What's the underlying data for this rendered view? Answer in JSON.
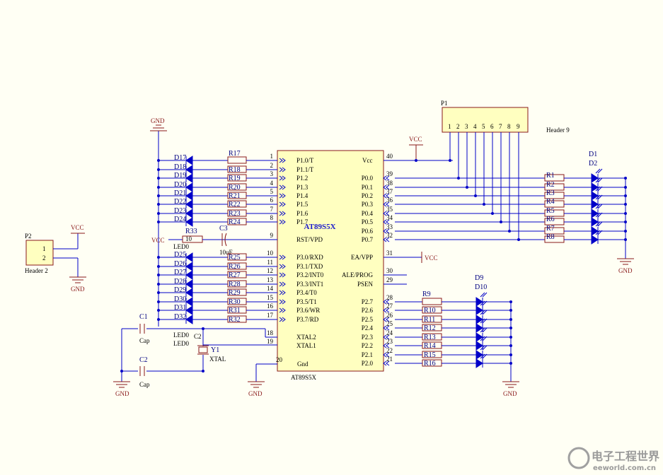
{
  "colors": {
    "wire": "#0000c8",
    "component": "#8a1a1a",
    "chip_fill": "#ffffc0",
    "background": "#fffff4",
    "chip_title": "#1a1acc"
  },
  "mcu": {
    "designator": "AT89S5X",
    "name": "AT89S5X",
    "vcc_label": "Vcc",
    "vcc_pin": "40",
    "gnd_label": "Gnd",
    "gnd_pin": "20",
    "left_pins": [
      {
        "num": "1",
        "name": "P1.0/T"
      },
      {
        "num": "2",
        "name": "P1.1/T"
      },
      {
        "num": "3",
        "name": "P1.2"
      },
      {
        "num": "4",
        "name": "P1.3"
      },
      {
        "num": "5",
        "name": "P1.4"
      },
      {
        "num": "6",
        "name": "P1.5"
      },
      {
        "num": "7",
        "name": "P1.6"
      },
      {
        "num": "8",
        "name": "P1.7"
      },
      {
        "num": "9",
        "name": "RST/VPD"
      },
      {
        "num": "10",
        "name": "P3.0/RXD"
      },
      {
        "num": "11",
        "name": "P3.1/TXD"
      },
      {
        "num": "12",
        "name": "P3.2/INT0"
      },
      {
        "num": "13",
        "name": "P3.3/INT1"
      },
      {
        "num": "14",
        "name": "P3.4/T0"
      },
      {
        "num": "15",
        "name": "P3.5/T1"
      },
      {
        "num": "16",
        "name": "P3.6/WR"
      },
      {
        "num": "17",
        "name": "P3.7/RD"
      },
      {
        "num": "18",
        "name": "XTAL2"
      },
      {
        "num": "19",
        "name": "XTAL1"
      }
    ],
    "right_pins": [
      {
        "num": "39",
        "name": "P0.0"
      },
      {
        "num": "38",
        "name": "P0.1"
      },
      {
        "num": "37",
        "name": "P0.2"
      },
      {
        "num": "36",
        "name": "P0.3"
      },
      {
        "num": "35",
        "name": "P0.4"
      },
      {
        "num": "34",
        "name": "P0.5"
      },
      {
        "num": "33",
        "name": "P0.6"
      },
      {
        "num": "32",
        "name": "P0.7"
      },
      {
        "num": "31",
        "name": "EA/VPP"
      },
      {
        "num": "30",
        "name": "ALE/PROG"
      },
      {
        "num": "29",
        "name": "PSEN"
      },
      {
        "num": "28",
        "name": "P2.7"
      },
      {
        "num": "27",
        "name": "P2.6"
      },
      {
        "num": "26",
        "name": "P2.5"
      },
      {
        "num": "25",
        "name": "P2.4"
      },
      {
        "num": "24",
        "name": "P2.3"
      },
      {
        "num": "23",
        "name": "P2.2"
      },
      {
        "num": "22",
        "name": "P2.1"
      },
      {
        "num": "21",
        "name": "P2.0"
      }
    ]
  },
  "header9": {
    "designator": "P1",
    "name": "Header 9",
    "pins": [
      "1",
      "2",
      "3",
      "4",
      "5",
      "6",
      "7",
      "8",
      "9"
    ]
  },
  "header2": {
    "designator": "P2",
    "name": "Header 2",
    "pins": [
      "1",
      "2"
    ]
  },
  "power": {
    "vcc": "VCC",
    "gnd": "GND"
  },
  "p0_resistors": [
    "R1",
    "R2",
    "R3",
    "R4",
    "R5",
    "R6",
    "R7",
    "R8"
  ],
  "p0_leds": [
    "D1",
    "D2"
  ],
  "p2_resistors": [
    "R9",
    "R10",
    "R11",
    "R12",
    "R13",
    "R14",
    "R15",
    "R16"
  ],
  "p2_leds": [
    "D9",
    "D10"
  ],
  "p1_resistors": [
    "R17",
    "R18",
    "R19",
    "R20",
    "R21",
    "R22",
    "R23",
    "R24"
  ],
  "p1_leds": [
    "D17",
    "D18",
    "D19",
    "D20",
    "D21",
    "D22",
    "D23",
    "D24"
  ],
  "p3_resistors": [
    "R25",
    "R26",
    "R27",
    "R28",
    "R29",
    "R30",
    "R31",
    "R32"
  ],
  "p3_leds": [
    "D25",
    "D26",
    "D27",
    "D28",
    "D29",
    "D30",
    "D31",
    "D32"
  ],
  "reset": {
    "resistor": "R33",
    "resistor_value": "10",
    "cap": "C3",
    "cap_value": "10uF",
    "led": "LED0"
  },
  "crystal": {
    "c1": "C1",
    "c2": "C2",
    "cap_value": "Cap",
    "crystal": "Y1",
    "crystal_value": "XTAL",
    "led": "LED0",
    "c_mid": "C2"
  },
  "watermark": {
    "line1": "电子工程世界",
    "line2": "eeworld.com.cn"
  }
}
